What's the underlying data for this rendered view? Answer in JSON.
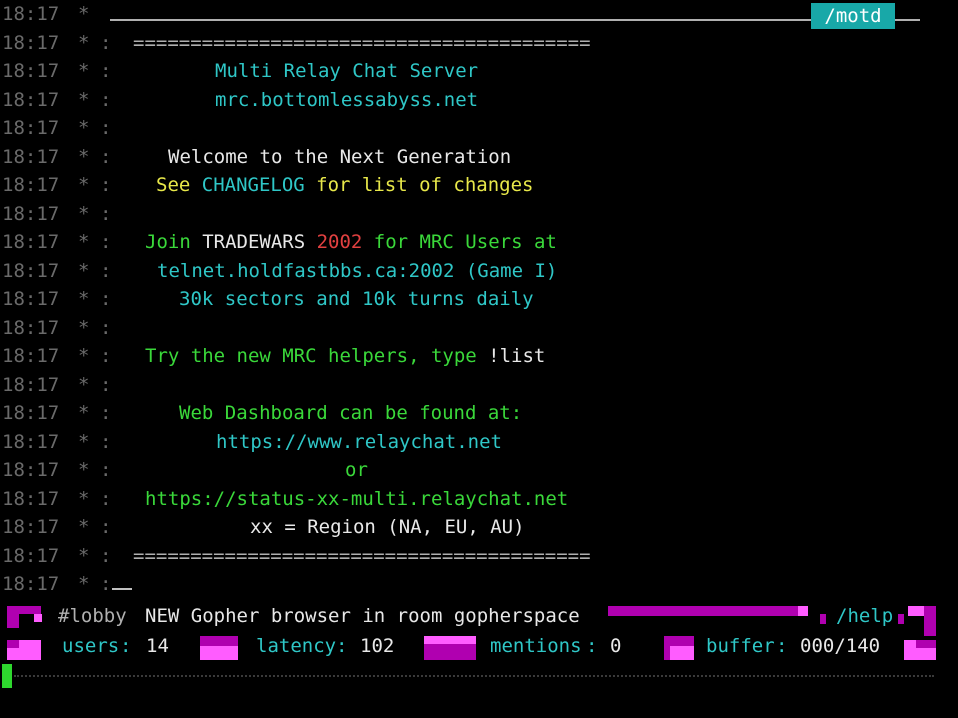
{
  "window": {
    "tab_label": "/motd"
  },
  "gutter": {
    "time": "18:17",
    "star": "*",
    "sep": ":"
  },
  "lines": [
    {
      "time": "18:17",
      "segments": []
    },
    {
      "time": "18:17",
      "segments": [
        {
          "text": "========================================",
          "color": "grey"
        }
      ]
    },
    {
      "time": "18:17",
      "segments": [
        {
          "text": "Multi Relay Chat Server",
          "color": "cyan"
        }
      ]
    },
    {
      "time": "18:17",
      "segments": [
        {
          "text": "mrc.bottomlessabyss.net",
          "color": "cyan"
        }
      ]
    },
    {
      "time": "18:17",
      "segments": []
    },
    {
      "time": "18:17",
      "segments": [
        {
          "text": "Welcome to the Next Generation",
          "color": "white"
        }
      ]
    },
    {
      "time": "18:17",
      "segments": [
        {
          "text": "See ",
          "color": "yellow"
        },
        {
          "text": "CHANGELOG",
          "color": "cyan"
        },
        {
          "text": " for list of changes",
          "color": "yellow"
        }
      ]
    },
    {
      "time": "18:17",
      "segments": []
    },
    {
      "time": "18:17",
      "segments": [
        {
          "text": "Join ",
          "color": "green"
        },
        {
          "text": "TRADEWARS ",
          "color": "white"
        },
        {
          "text": "2002",
          "color": "red"
        },
        {
          "text": " for MRC Users at",
          "color": "green"
        }
      ]
    },
    {
      "time": "18:17",
      "segments": [
        {
          "text": "telnet.holdfastbbs.ca:2002 (Game I)",
          "color": "cyan"
        }
      ]
    },
    {
      "time": "18:17",
      "segments": [
        {
          "text": "30k sectors and 10k turns daily",
          "color": "cyan"
        }
      ]
    },
    {
      "time": "18:17",
      "segments": []
    },
    {
      "time": "18:17",
      "segments": [
        {
          "text": "Try the new MRC helpers, type ",
          "color": "green"
        },
        {
          "text": "!list",
          "color": "white"
        }
      ]
    },
    {
      "time": "18:17",
      "segments": []
    },
    {
      "time": "18:17",
      "segments": [
        {
          "text": "Web Dashboard can be found at:",
          "color": "green"
        }
      ]
    },
    {
      "time": "18:17",
      "segments": [
        {
          "text": "https://www.relaychat.net",
          "color": "cyan"
        }
      ]
    },
    {
      "time": "18:17",
      "segments": [
        {
          "text": "or",
          "color": "green"
        }
      ]
    },
    {
      "time": "18:17",
      "segments": [
        {
          "text": "https://status-xx-multi.relaychat.net",
          "color": "green"
        }
      ]
    },
    {
      "time": "18:17",
      "segments": [
        {
          "text": "xx = Region (NA, EU, AU)",
          "color": "white"
        }
      ]
    },
    {
      "time": "18:17",
      "segments": [
        {
          "text": "========================================",
          "color": "grey"
        }
      ]
    },
    {
      "time": "18:17",
      "segments": []
    }
  ],
  "statusbar": {
    "room": "#lobby",
    "topic": "NEW Gopher browser in room gopherspace",
    "help": "/help",
    "users_label": "users",
    "users_value": "14",
    "latency_label": "latency",
    "latency_value": "102",
    "mentions_label": "mentions",
    "mentions_value": "0",
    "buffer_label": "buffer",
    "buffer_value": "000/140"
  },
  "input": {
    "value": ""
  },
  "colors": {
    "cyan": "#2fc7c7",
    "white": "#e8e8e8",
    "yellow": "#e8e84a",
    "green": "#3ad83a",
    "red": "#e04040",
    "grey": "#b0b0b0",
    "magenta": "#b000b0",
    "pink": "#ff5cff"
  }
}
